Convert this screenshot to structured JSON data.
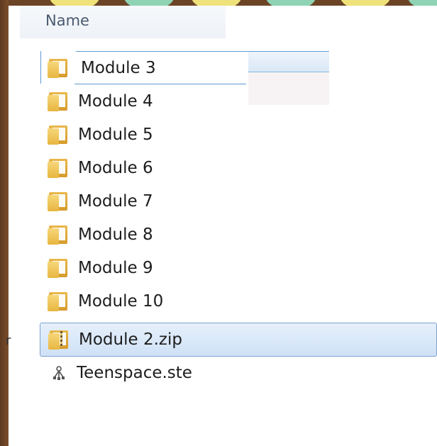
{
  "header": {
    "column_label": "Name"
  },
  "rename": {
    "current_value": "Module 3"
  },
  "items": [
    {
      "label": "Module 3",
      "icon": "folder-icon"
    },
    {
      "label": "Module 4",
      "icon": "folder-icon"
    },
    {
      "label": "Module 5",
      "icon": "folder-icon"
    },
    {
      "label": "Module 6",
      "icon": "folder-icon"
    },
    {
      "label": "Module 7",
      "icon": "folder-icon"
    },
    {
      "label": "Module 8",
      "icon": "folder-icon"
    },
    {
      "label": "Module 9",
      "icon": "folder-icon"
    },
    {
      "label": "Module 10",
      "icon": "folder-icon"
    },
    {
      "label": "Module 2.zip",
      "icon": "zip-folder-icon",
      "selected": true
    },
    {
      "label": "Teenspace.ste",
      "icon": "site-file-icon"
    }
  ],
  "colors": {
    "background": "#6b4426",
    "selection": "#cfe1f6",
    "selection_border": "#7da2ce",
    "folder": "#e7b640"
  }
}
